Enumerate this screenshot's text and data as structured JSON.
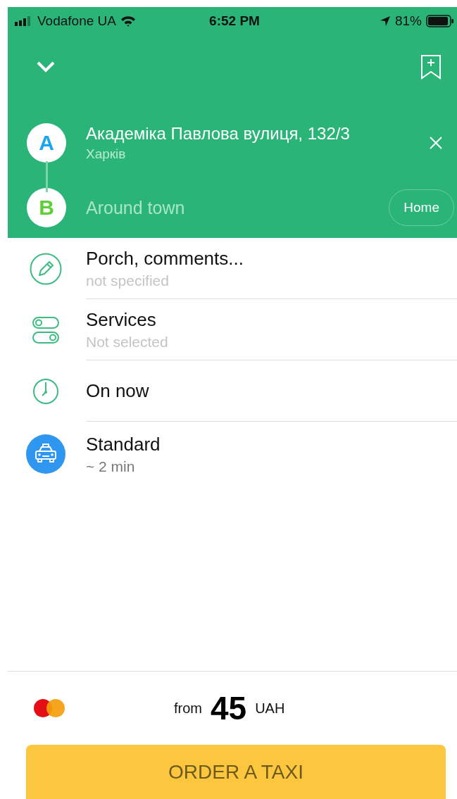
{
  "status_bar": {
    "carrier": "Vodafone UA",
    "time": "6:52 PM",
    "battery": "81%"
  },
  "route": {
    "points": [
      {
        "letter": "A",
        "title": "Академіка Павлова вулиця, 132/3",
        "subtitle": "Харків",
        "filled": true,
        "kind": "clearable"
      },
      {
        "letter": "B",
        "title": "Around town",
        "filled": false,
        "kind": "shortcut",
        "shortcut": "Home"
      }
    ]
  },
  "options": [
    {
      "kind": "comment",
      "title": "Porch, comments...",
      "subtitle": "not specified"
    },
    {
      "kind": "services",
      "title": "Services",
      "subtitle": "Not selected"
    },
    {
      "kind": "time",
      "title": "On now"
    },
    {
      "kind": "tariff",
      "title": "Standard",
      "subtitle": "~ 2 min"
    }
  ],
  "price": {
    "prefix": "from",
    "amount": "45",
    "currency": "UAH"
  },
  "order_button": "ORDER A TAXI"
}
